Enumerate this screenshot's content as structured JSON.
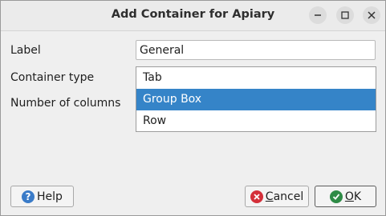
{
  "window": {
    "title": "Add Container for Apiary"
  },
  "form": {
    "label_label": "Label",
    "label_value": "General",
    "container_type_label": "Container type",
    "columns_label": "Number of columns"
  },
  "dropdown": {
    "options": [
      "Tab",
      "Group Box",
      "Row"
    ],
    "selected": "Group Box"
  },
  "buttons": {
    "help": "Help",
    "cancel_rest": "ancel",
    "cancel_mnemonic": "C",
    "ok_mnemonic": "O",
    "ok_rest": "K"
  },
  "colors": {
    "selection": "#3584c8",
    "cancel_icon": "#d4303a",
    "ok_icon": "#2e8b46",
    "help_icon": "#3a7bc8"
  }
}
